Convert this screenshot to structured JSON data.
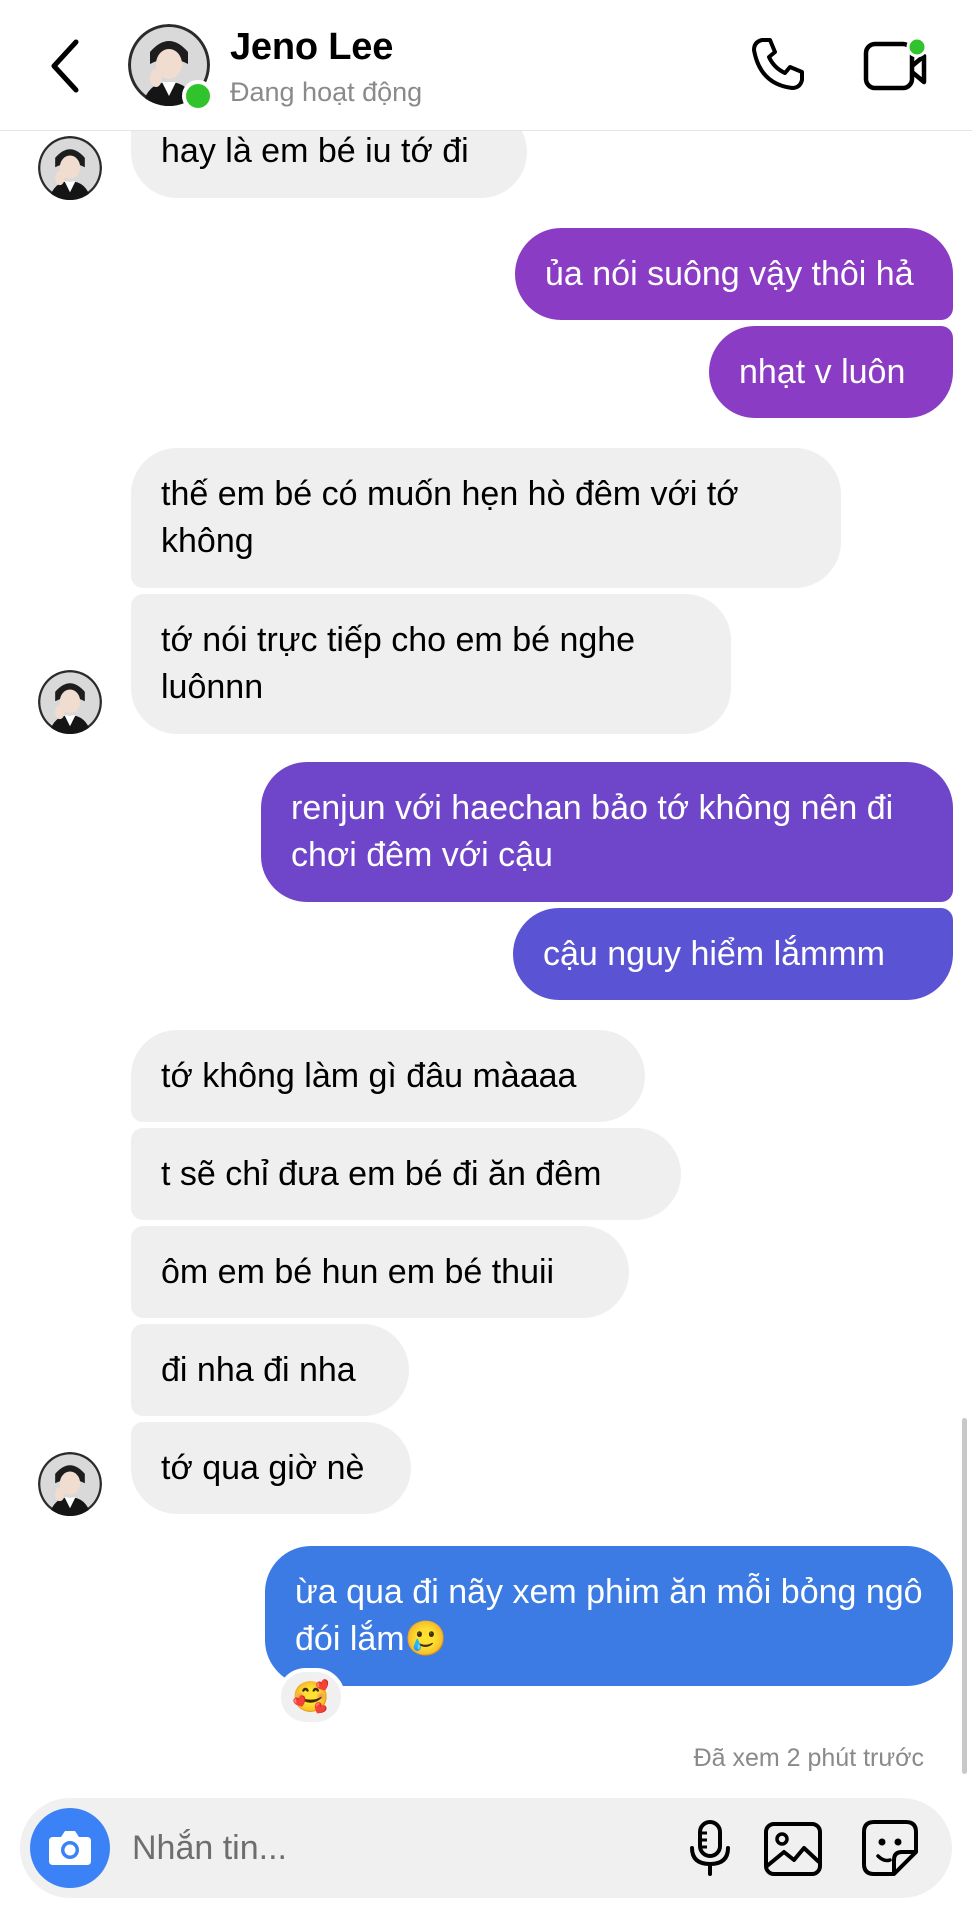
{
  "header": {
    "name": "Jeno Lee",
    "status": "Đang hoạt động"
  },
  "messages": [
    {
      "side": "in",
      "text": "hay là em bé iu tớ đi"
    },
    {
      "side": "out",
      "text": "ủa nói suông vậy thôi hả"
    },
    {
      "side": "out",
      "text": "nhạt v luôn"
    },
    {
      "side": "in",
      "text": "thế em bé có muốn hẹn hò đêm với tớ không"
    },
    {
      "side": "in",
      "text": "tớ nói trực tiếp cho em bé nghe luônnn"
    },
    {
      "side": "out",
      "text": "renjun với haechan bảo tớ không nên đi chơi đêm với cậu"
    },
    {
      "side": "out",
      "text": "cậu nguy hiểm lắmmm"
    },
    {
      "side": "in",
      "text": "tớ không làm gì đâu màaaa"
    },
    {
      "side": "in",
      "text": "t sẽ chỉ đưa em bé đi ăn đêm"
    },
    {
      "side": "in",
      "text": "ôm em bé hun em bé thuii"
    },
    {
      "side": "in",
      "text": "đi nha đi nha"
    },
    {
      "side": "in",
      "text": "tớ qua giờ nè"
    },
    {
      "side": "out",
      "text": "ừa qua đi nãy xem phim ăn mỗi bỏng ngô đói lắm🥲"
    }
  ],
  "reaction": "🥰",
  "seen_status": "Đã xem 2 phút trước",
  "composer": {
    "placeholder": "Nhắn tin..."
  },
  "colors": {
    "incoming_bubble": "#efefef",
    "outgoing_purple": "#8b3cc4",
    "outgoing_indigo": "#5a54d4",
    "outgoing_blue": "#3b7be3",
    "online": "#31c32d",
    "camera_button": "#3b82f6"
  }
}
